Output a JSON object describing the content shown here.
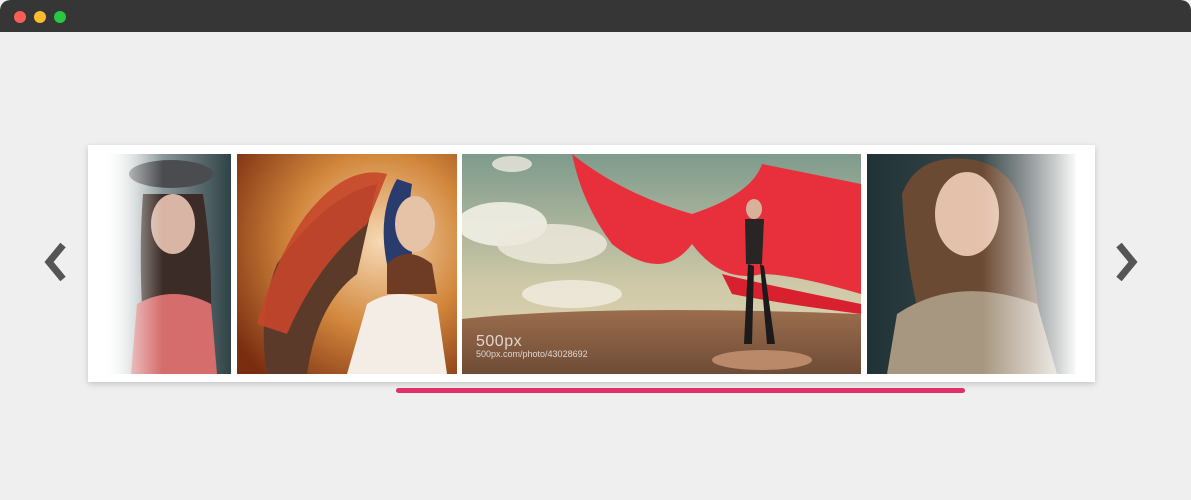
{
  "slider": {
    "prev_icon": "chevron-left-icon",
    "next_icon": "chevron-right-icon",
    "progress": 1.0,
    "accent_color": "#e0306a",
    "slides": [
      {
        "alt": "Girl in hat"
      },
      {
        "alt": "Woman with feather headdress"
      },
      {
        "alt": "Woman with red fabric",
        "watermark_logo": "500px",
        "watermark_url": "500px.com/photo/43028692"
      },
      {
        "alt": "Woman in knit sweater"
      }
    ]
  }
}
